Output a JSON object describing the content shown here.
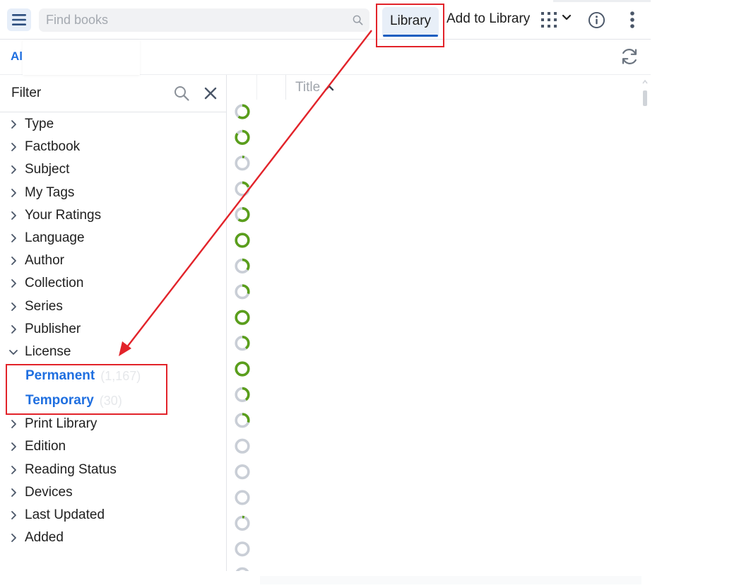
{
  "topbar": {
    "search_placeholder": "Find books",
    "tabs": [
      {
        "label": "Library",
        "active": true
      },
      {
        "label": "Add to Library",
        "active": false
      }
    ]
  },
  "subbar": {
    "scope_label": "All"
  },
  "filter": {
    "title": "Filter",
    "sections_before": [
      {
        "label": "Type"
      },
      {
        "label": "Factbook"
      },
      {
        "label": "Subject"
      },
      {
        "label": "My Tags"
      },
      {
        "label": "Your Ratings"
      },
      {
        "label": "Language"
      },
      {
        "label": "Author"
      },
      {
        "label": "Collection"
      },
      {
        "label": "Series"
      },
      {
        "label": "Publisher"
      }
    ],
    "expanded_section": {
      "label": "License",
      "options": [
        {
          "label": "Permanent",
          "count": "(1,167)"
        },
        {
          "label": "Temporary",
          "count": "(30)"
        }
      ]
    },
    "sections_after": [
      {
        "label": "Print Library"
      },
      {
        "label": "Edition"
      },
      {
        "label": "Reading Status"
      },
      {
        "label": "Devices"
      },
      {
        "label": "Last Updated"
      },
      {
        "label": "Added"
      }
    ]
  },
  "list": {
    "column_title": "Title",
    "sort": "ascending",
    "reading_progress": [
      0.6,
      0.85,
      0.05,
      0.2,
      0.6,
      1.0,
      0.35,
      0.3,
      1.0,
      0.4,
      1.0,
      0.4,
      0.3,
      0.0,
      0.0,
      0.0,
      0.05,
      0.0,
      0.0
    ]
  },
  "colors": {
    "accent": "#1f6fe0",
    "active_tab_underline": "#1b5dc0",
    "progress_done": "#5a9e1c",
    "progress_track": "#c9ced6",
    "annotation": "#e2232a"
  }
}
